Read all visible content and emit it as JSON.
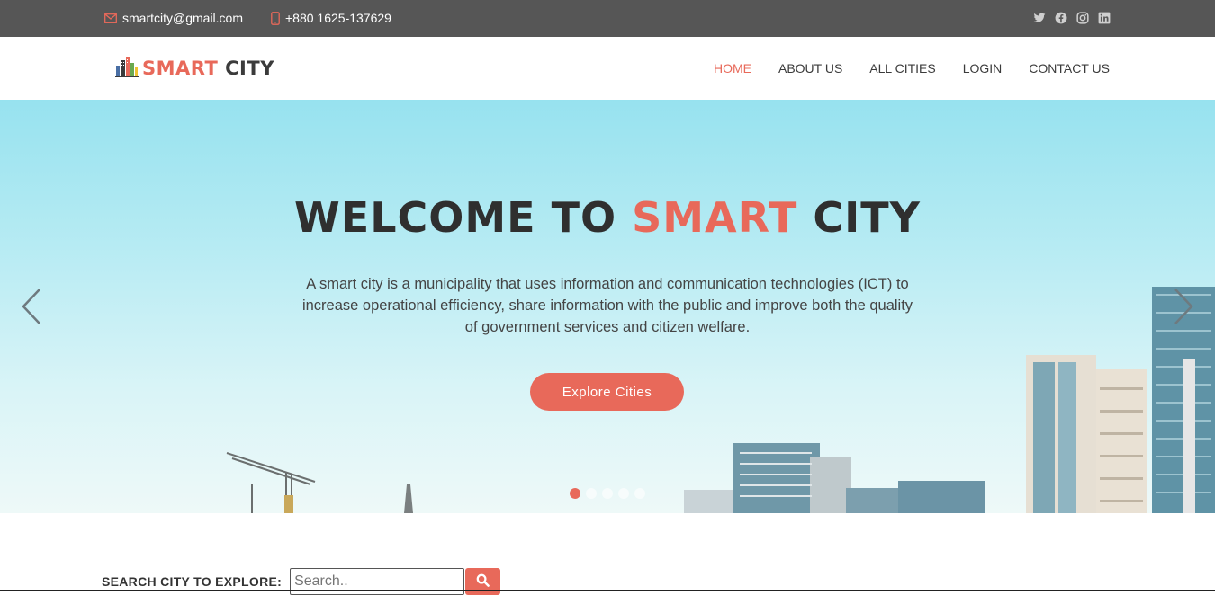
{
  "topbar": {
    "email": "smartcity@gmail.com",
    "phone": "+880 1625-137629",
    "socials": [
      "twitter-icon",
      "facebook-icon",
      "instagram-icon",
      "linkedin-icon"
    ]
  },
  "brand": {
    "word1": "SMART",
    "word2": "CITY"
  },
  "nav": {
    "items": [
      {
        "label": "HOME",
        "active": true
      },
      {
        "label": "ABOUT US"
      },
      {
        "label": "ALL CITIES"
      },
      {
        "label": "LOGIN"
      },
      {
        "label": "CONTACT US"
      }
    ]
  },
  "hero": {
    "title_part1": "WELCOME TO",
    "title_accent": "SMART",
    "title_part2": "CITY",
    "description": "A smart city is a municipality that uses information and communication technologies (ICT) to increase operational efficiency, share information with the public and improve both the quality of government services and citizen welfare.",
    "button": "Explore Cities",
    "slide_count": 5,
    "active_slide": 1
  },
  "search": {
    "label": "SEARCH CITY TO EXPLORE:",
    "placeholder": "Search.."
  },
  "colors": {
    "accent": "#e8695a",
    "topbar": "#565656",
    "text": "#3b3b3b"
  }
}
